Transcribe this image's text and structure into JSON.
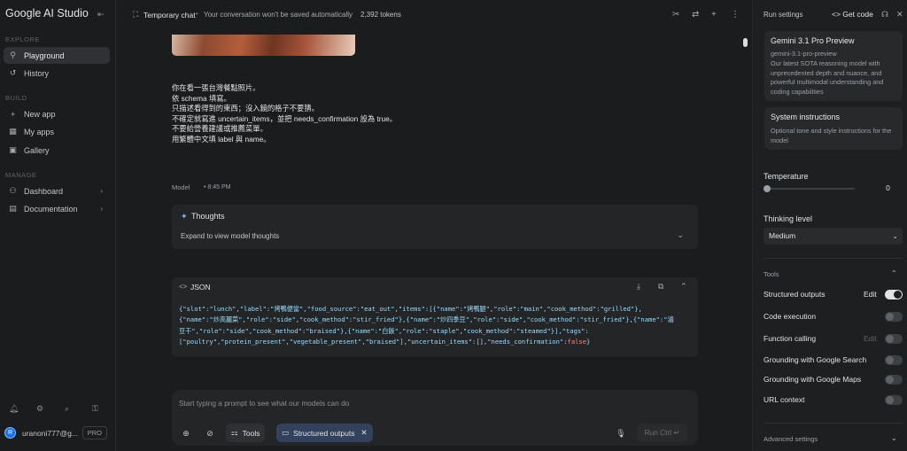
{
  "sidebar": {
    "brand": "Google AI Studio",
    "sections": {
      "explore": "EXPLORE",
      "build": "BUILD",
      "manage": "MANAGE"
    },
    "items": [
      {
        "label": "Playground",
        "icon": "playground-icon"
      },
      {
        "label": "History",
        "icon": "history-icon"
      },
      {
        "label": "New app",
        "icon": "plus-icon"
      },
      {
        "label": "My apps",
        "icon": "apps-icon"
      },
      {
        "label": "Gallery",
        "icon": "gallery-icon"
      },
      {
        "label": "Dashboard",
        "icon": "dashboard-icon"
      },
      {
        "label": "Documentation",
        "icon": "documentation-icon"
      }
    ],
    "account": {
      "initial": "R",
      "email": "uranoni777@g...",
      "plan": "PRO"
    }
  },
  "topbar": {
    "title": "Temporary chat",
    "subtitle": "Your conversation won't be saved automatically",
    "tokens": "2,392 tokens"
  },
  "chat": {
    "user_lines": [
      "你在看一張台灣餐點照片。",
      "依 schema 填寫。",
      "只描述看得到的東西；沒入鏡的格子不要猜。",
      "不確定就寫進 uncertain_items，並把 needs_confirmation 設為 true。",
      "不要給營養建議或推薦菜單。",
      "用繁體中文填 label 與 name。"
    ],
    "model_label": "Model",
    "model_time": "8:45 PM",
    "thoughts_title": "Thoughts",
    "thoughts_expand": "Expand to view model thoughts",
    "json_title": "JSON",
    "json_lines": [
      "{\"slot\":\"lunch\",\"label\":\"烤鴨便當\",\"food_source\":\"eat_out\",\"items\":[{\"name\":\"烤鴨腿\",\"role\":\"main\",\"cook_method\":\"grilled\"},",
      "{\"name\":\"炒高麗菜\",\"role\":\"side\",\"cook_method\":\"stir_fried\"},{\"name\":\"炒四季豆\",\"role\":\"side\",\"cook_method\":\"stir_fried\"},{\"name\":\"滷",
      "豆干\",\"role\":\"side\",\"cook_method\":\"braised\"},{\"name\":\"白飯\",\"role\":\"staple\",\"cook_method\":\"steamed\"}],\"tags\":",
      "[\"poultry\",\"protein_present\",\"vegetable_present\",\"braised\"],\"uncertain_items\":[],\"needs_confirmation\":"
    ],
    "json_bool": "false",
    "json_close": "}"
  },
  "prompt": {
    "placeholder": "Start typing a prompt to see what our models can do",
    "tools_label": "Tools",
    "chip_label": "Structured outputs",
    "run_label": "Run Ctrl ↵"
  },
  "settings": {
    "title": "Run settings",
    "get_code": "Get code",
    "model_name": "Gemini 3.1 Pro Preview",
    "model_id": "gemini-3.1-pro-preview",
    "model_desc": "Our latest SOTA reasoning model with unprecedented depth and nuance, and powerful multimodal understanding and coding capabilities",
    "sys_title": "System instructions",
    "sys_desc": "Optional tone and style instructions for the model",
    "temperature_label": "Temperature",
    "temperature_value": "0",
    "thinking_label": "Thinking level",
    "thinking_value": "Medium",
    "tools_head": "Tools",
    "tools": [
      {
        "label": "Structured outputs",
        "edit": "Edit",
        "on": true
      },
      {
        "label": "Code execution",
        "on": false
      },
      {
        "label": "Function calling",
        "edit": "Edit",
        "on": false
      },
      {
        "label": "Grounding with Google Search",
        "on": false
      },
      {
        "label": "Grounding with Google Maps",
        "on": false
      },
      {
        "label": "URL context",
        "on": false
      }
    ],
    "advanced": "Advanced settings"
  }
}
